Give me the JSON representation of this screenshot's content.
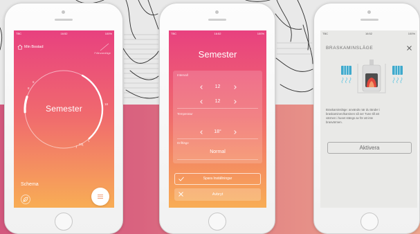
{
  "colors": {
    "band_left": "#d3587d",
    "band_right": "#efa58d",
    "screen_top": "#e8417f",
    "screen_bottom": "#f8ad55",
    "settings_bg": "#e9e9e7",
    "fire": "#e0473c",
    "radiator": "#3fa9cc"
  },
  "phone1": {
    "status": {
      "carrier": "TBC",
      "time": "16:52",
      "battery": "100%"
    },
    "header": {
      "icon": "home-icon",
      "home_label": "Min Bostad",
      "mode_label": "Frånvaroläge"
    },
    "dial": {
      "center_label": "Semester",
      "ticks": [
        "6",
        "8",
        "18",
        "22"
      ]
    },
    "schedule_label": "Schema",
    "buttons": {
      "left_icon": "leaf-icon",
      "right_icon": "menu-icon"
    }
  },
  "phone2": {
    "status": {
      "carrier": "TBC",
      "time": "16:52",
      "battery": "100%"
    },
    "title": "Semester",
    "section_label": "Intervall",
    "start_value": "12",
    "end_value": "12",
    "temperature_label": "Temperatur",
    "temperature_value": "18°",
    "mode_label": "Driftläge",
    "mode_value": "Normal",
    "save_label": "Spara Inställningar",
    "cancel_label": "Avbryt"
  },
  "phone3": {
    "status": {
      "carrier": "TBC",
      "time": "16:52",
      "battery": "100%"
    },
    "title": "BRASKAMINSLÄGE",
    "close_icon": "close-icon",
    "illustration": [
      "radiator-icon",
      "stove-icon",
      "radiator-icon"
    ],
    "description": [
      "Braskaminsläge: används när du tänder i",
      "braskaminen/kaminen så ser Tune till att",
      "värmen i huset stängs av för att inte",
      "brasvärmen."
    ],
    "activate_label": "Aktivera"
  }
}
